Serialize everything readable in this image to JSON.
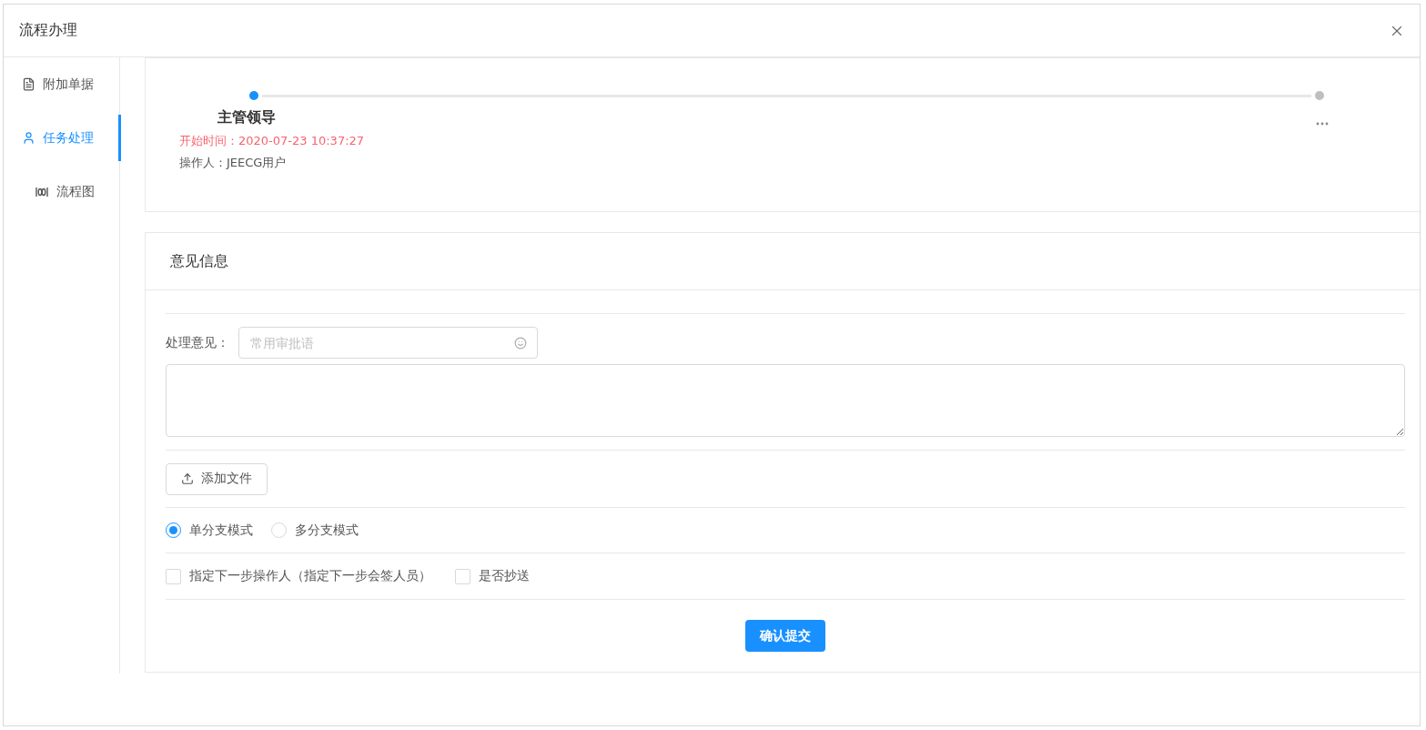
{
  "window": {
    "title": "流程办理"
  },
  "sidebar": {
    "items": [
      {
        "label": "附加单据",
        "selected": false
      },
      {
        "label": "任务处理",
        "selected": true
      },
      {
        "label": "流程图",
        "selected": false
      }
    ]
  },
  "steps": [
    {
      "title": "主管领导",
      "start_time": "开始时间：2020-07-23 10:37:27",
      "operator": "操作人：JEECG用户",
      "active": true
    },
    {
      "active": false
    }
  ],
  "opinion": {
    "title": "意见信息",
    "label": "处理意见：",
    "placeholder": "常用审批语",
    "upload_button": "添加文件",
    "modes": [
      {
        "label": "单分支模式",
        "selected": true
      },
      {
        "label": "多分支模式",
        "selected": false
      }
    ],
    "checks": [
      {
        "label": "指定下一步操作人（指定下一步会签人员）",
        "checked": false
      },
      {
        "label": "是否抄送",
        "checked": false
      }
    ],
    "submit": "确认提交"
  }
}
